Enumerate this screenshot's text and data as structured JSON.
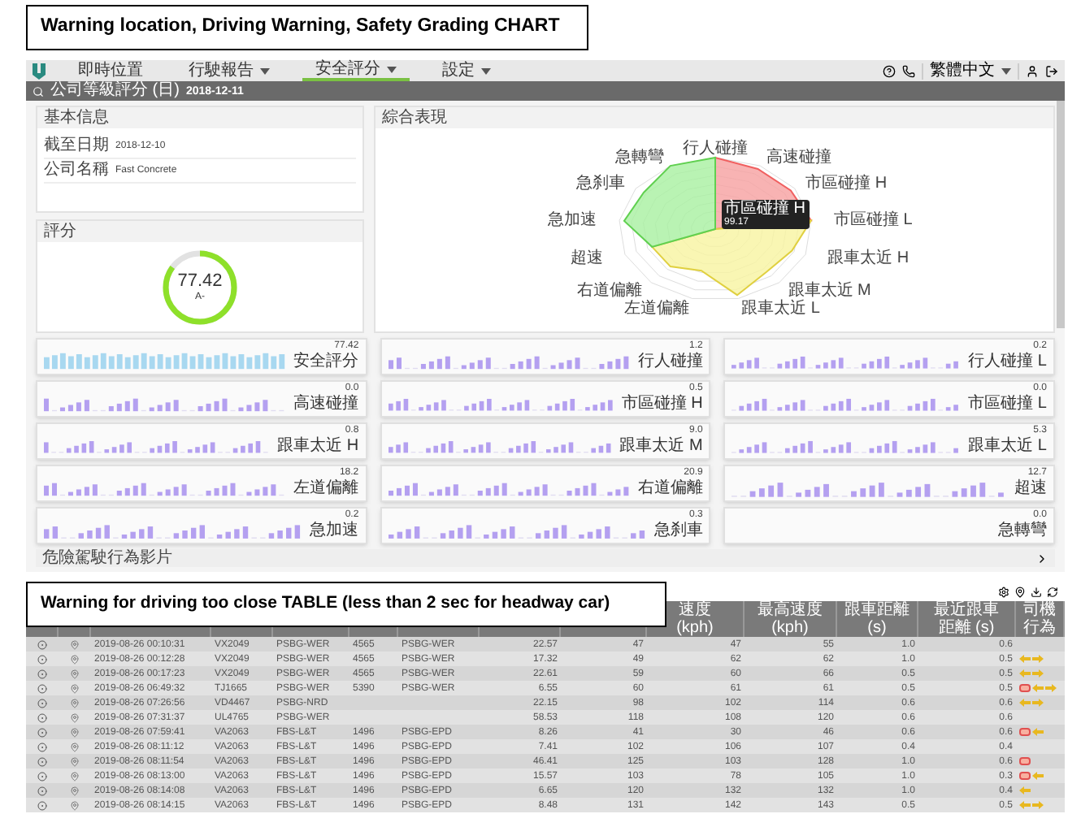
{
  "captions": [
    "Warning location, Driving Warning, Safety Grading CHART",
    "Warning for driving too close TABLE (less than 2 sec for headway car)"
  ],
  "nav": {
    "items": [
      {
        "label": "即時位置",
        "dropdown": false,
        "selected": false
      },
      {
        "label": "行駛報告",
        "dropdown": true,
        "selected": false
      },
      {
        "label": "安全評分",
        "dropdown": true,
        "selected": true
      },
      {
        "label": "設定",
        "dropdown": true,
        "selected": false
      }
    ],
    "language": "繁體中文"
  },
  "search_bar": {
    "label": "公司等級評分 (日)",
    "date": "2018-12-11"
  },
  "info_card": {
    "title": "基本信息",
    "rows": [
      {
        "label": "截至日期",
        "value": "2018-12-10"
      },
      {
        "label": "公司名稱",
        "value": "Fast Concrete"
      }
    ]
  },
  "score_card": {
    "title": "評分",
    "score": "77.42",
    "grade": "A-",
    "level": 0.85
  },
  "radar_card": {
    "title": "綜合表現",
    "axes_right": [
      "行人碰撞",
      "高速碰撞",
      "市區碰撞 H",
      "市區碰撞 L",
      "跟車太近 H",
      "跟車太近 M",
      "跟車太近 L"
    ],
    "axes_left": [
      "急轉彎",
      "急刹車",
      "急加速",
      "超速",
      "右道偏離",
      "左道偏離"
    ],
    "tooltip": {
      "label": "市區碰撞 H",
      "value": "99.17"
    }
  },
  "metrics": [
    {
      "value": "77.42",
      "label": "安全評分",
      "kind": "score"
    },
    {
      "value": "1.2",
      "label": "行人碰撞",
      "kind": "event"
    },
    {
      "value": "0.2",
      "label": "行人碰撞 L",
      "kind": "event"
    },
    {
      "value": "0.0",
      "label": "高速碰撞",
      "kind": "event"
    },
    {
      "value": "0.5",
      "label": "市區碰撞 H",
      "kind": "event"
    },
    {
      "value": "0.0",
      "label": "市區碰撞 L",
      "kind": "event"
    },
    {
      "value": "0.8",
      "label": "跟車太近 H",
      "kind": "event"
    },
    {
      "value": "9.0",
      "label": "跟車太近 M",
      "kind": "event"
    },
    {
      "value": "5.3",
      "label": "跟車太近 L",
      "kind": "event"
    },
    {
      "value": "18.2",
      "label": "左道偏離",
      "kind": "event"
    },
    {
      "value": "20.9",
      "label": "右道偏離",
      "kind": "event"
    },
    {
      "value": "12.7",
      "label": "超速",
      "kind": "event"
    },
    {
      "value": "0.2",
      "label": "急加速",
      "kind": "event"
    },
    {
      "value": "0.3",
      "label": "急刹車",
      "kind": "event"
    },
    {
      "value": "0.0",
      "label": "急轉彎",
      "kind": "empty"
    }
  ],
  "video_bar": {
    "label": "危險駕駛行為影片"
  },
  "table": {
    "columns": {
      "speed": "速度 (kph)",
      "max_speed": "最高速度 (kph)",
      "headway": "跟車距離 (s)",
      "min_headway": "最近跟車距離 (s)",
      "behaviors": "司機行為"
    },
    "rows": [
      {
        "time": "2019-08-26 00:10:31",
        "plate": "VX2049",
        "fleet": "PSBG-WER",
        "code": "4565",
        "dest": "PSBG-WER",
        "duration": "22.57",
        "column_9": "47",
        "speed": "47",
        "max_speed": "55",
        "headway": "1.0",
        "min_headway": "0.6"
      },
      {
        "time": "2019-08-26 00:12:28",
        "plate": "VX2049",
        "fleet": "PSBG-WER",
        "code": "4565",
        "dest": "PSBG-WER",
        "duration": "17.32",
        "column_9": "49",
        "speed": "62",
        "max_speed": "62",
        "headway": "1.0",
        "min_headway": "0.5",
        "behaviors": [
          {
            "kind": "left"
          },
          {
            "kind": "right"
          }
        ]
      },
      {
        "time": "2019-08-26 00:17:23",
        "plate": "VX2049",
        "fleet": "PSBG-WER",
        "code": "4565",
        "dest": "PSBG-WER",
        "duration": "22.61",
        "column_9": "59",
        "speed": "60",
        "max_speed": "66",
        "headway": "0.5",
        "min_headway": "0.5",
        "behaviors": [
          {
            "kind": "left"
          },
          {
            "kind": "right"
          }
        ]
      },
      {
        "time": "2019-08-26 06:49:32",
        "plate": "TJ1665",
        "fleet": "PSBG-WER",
        "code": "5390",
        "dest": "PSBG-WER",
        "duration": "6.55",
        "column_9": "60",
        "speed": "61",
        "max_speed": "61",
        "headway": "0.5",
        "min_headway": "0.5",
        "behaviors": [
          {
            "kind": "alert"
          },
          {
            "kind": "left"
          },
          {
            "kind": "right"
          }
        ]
      },
      {
        "time": "2019-08-26 07:26:56",
        "plate": "VD4467",
        "fleet": "PSBG-NRD",
        "duration": "22.15",
        "column_9": "98",
        "speed": "102",
        "max_speed": "114",
        "headway": "0.6",
        "min_headway": "0.6",
        "behaviors": [
          {
            "kind": "left"
          },
          {
            "kind": "right"
          }
        ]
      },
      {
        "time": "2019-08-26 07:31:37",
        "plate": "UL4765",
        "fleet": "PSBG-WER",
        "duration": "58.53",
        "column_9": "118",
        "speed": "108",
        "max_speed": "120",
        "headway": "0.6",
        "min_headway": "0.6"
      },
      {
        "time": "2019-08-26 07:59:41",
        "plate": "VA2063",
        "fleet": "FBS-L&T",
        "code": "1496",
        "dest": "PSBG-EPD",
        "duration": "8.26",
        "column_9": "41",
        "speed": "30",
        "max_speed": "46",
        "headway": "0.6",
        "min_headway": "0.6",
        "behaviors": [
          {
            "kind": "alert"
          },
          {
            "kind": "left"
          }
        ]
      },
      {
        "time": "2019-08-26 08:11:12",
        "plate": "VA2063",
        "fleet": "FBS-L&T",
        "code": "1496",
        "dest": "PSBG-EPD",
        "duration": "7.41",
        "column_9": "102",
        "speed": "106",
        "max_speed": "107",
        "headway": "0.4",
        "min_headway": "0.4"
      },
      {
        "time": "2019-08-26 08:11:54",
        "plate": "VA2063",
        "fleet": "FBS-L&T",
        "code": "1496",
        "dest": "PSBG-EPD",
        "duration": "46.41",
        "column_9": "125",
        "speed": "103",
        "max_speed": "128",
        "headway": "1.0",
        "min_headway": "0.6",
        "behaviors": [
          {
            "kind": "alert"
          }
        ]
      },
      {
        "time": "2019-08-26 08:13:00",
        "plate": "VA2063",
        "fleet": "FBS-L&T",
        "code": "1496",
        "dest": "PSBG-EPD",
        "duration": "15.57",
        "column_9": "103",
        "speed": "78",
        "max_speed": "105",
        "headway": "1.0",
        "min_headway": "0.3",
        "behaviors": [
          {
            "kind": "alert"
          },
          {
            "kind": "left"
          }
        ]
      },
      {
        "time": "2019-08-26 08:14:08",
        "plate": "VA2063",
        "fleet": "FBS-L&T",
        "code": "1496",
        "dest": "PSBG-EPD",
        "duration": "6.65",
        "column_9": "120",
        "speed": "132",
        "max_speed": "132",
        "headway": "1.0",
        "min_headway": "0.4",
        "behaviors": [
          {
            "kind": "left"
          }
        ]
      },
      {
        "time": "2019-08-26 08:14:15",
        "plate": "VA2063",
        "fleet": "FBS-L&T",
        "code": "1496",
        "dest": "PSBG-EPD",
        "duration": "8.48",
        "column_9": "131",
        "speed": "142",
        "max_speed": "143",
        "headway": "0.5",
        "min_headway": "0.5",
        "behaviors": [
          {
            "kind": "left"
          },
          {
            "kind": "right"
          }
        ]
      }
    ]
  }
}
